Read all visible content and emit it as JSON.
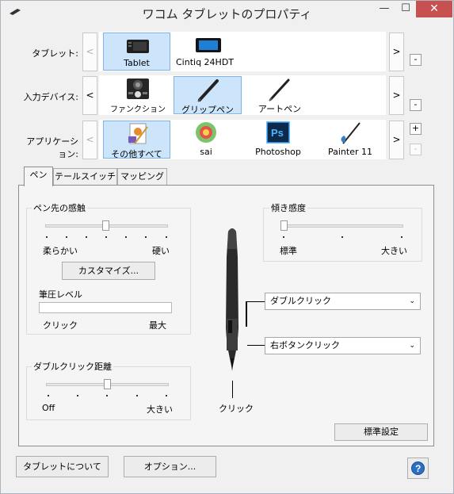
{
  "window": {
    "title": "ワコム タブレットのプロパティ",
    "minimize": "—",
    "maximize": "☐",
    "close": "✕"
  },
  "rows": {
    "tablet": {
      "label": "タブレット:",
      "nav_left": "<",
      "nav_right": ">",
      "items": [
        {
          "label": "Tablet",
          "icon": "tablet-icon",
          "selected": true
        },
        {
          "label": "Cintiq 24HDT",
          "icon": "cintiq-display-icon",
          "selected": false
        }
      ],
      "remove": "-"
    },
    "input_device": {
      "label": "入力デバイス:",
      "nav_left": "<",
      "nav_right": ">",
      "items": [
        {
          "label": "ファンクション",
          "icon": "functions-icon",
          "selected": false
        },
        {
          "label": "グリップペン",
          "icon": "grip-pen-icon",
          "selected": true
        },
        {
          "label": "アートペン",
          "icon": "art-pen-icon",
          "selected": false
        }
      ],
      "remove": "-"
    },
    "application": {
      "label": "アプリケーション:",
      "nav_left": "<",
      "nav_right": ">",
      "items": [
        {
          "label": "その他すべて",
          "icon": "all-apps-icon",
          "selected": true
        },
        {
          "label": "sai",
          "icon": "sai-icon",
          "selected": false
        },
        {
          "label": "Photoshop",
          "icon": "photoshop-icon",
          "selected": false,
          "icon_text": "Ps"
        },
        {
          "label": "Painter 11",
          "icon": "painter-icon",
          "selected": false
        }
      ],
      "add": "+",
      "remove": "-"
    }
  },
  "tabs": [
    {
      "label": "ペン",
      "active": true
    },
    {
      "label": "テールスイッチ",
      "active": false
    },
    {
      "label": "マッピング",
      "active": false
    }
  ],
  "tip_feel": {
    "title": "ペン先の感触",
    "soft": "柔らかい",
    "firm": "硬い",
    "slider_position": 0.5,
    "customize": "カスタマイズ...",
    "pressure_label": "筆圧レベル",
    "pressure_value": 0,
    "click": "クリック",
    "max": "最大"
  },
  "tilt": {
    "title": "傾き感度",
    "normal": "標準",
    "high": "大きい",
    "slider_position": 0.0
  },
  "double_click": {
    "title": "ダブルクリック距離",
    "off": "Off",
    "large": "大きい",
    "slider_position": 0.5
  },
  "pen_buttons": {
    "upper": "ダブルクリック",
    "lower": "右ボタンクリック",
    "tip": "クリック"
  },
  "default_button": "標準設定",
  "footer": {
    "about": "タブレットについて",
    "options": "オプション...",
    "help": "?"
  },
  "colors": {
    "selected_bg": "#cde5fb",
    "selected_border": "#7eb4ea",
    "close_red": "#c75050",
    "help_blue": "#2a6fc4"
  }
}
